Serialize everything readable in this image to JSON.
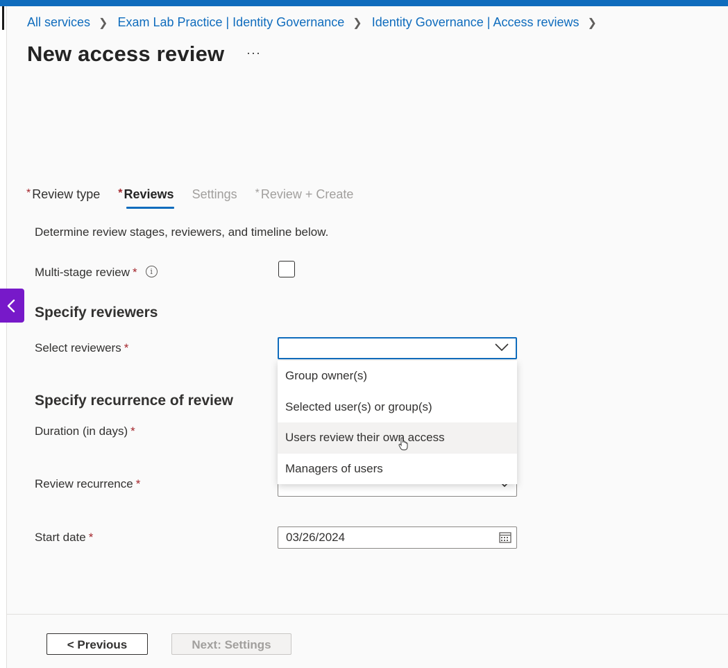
{
  "breadcrumb": {
    "items": [
      "All services",
      "Exam Lab Practice | Identity Governance",
      "Identity Governance | Access reviews"
    ]
  },
  "page": {
    "title": "New access review",
    "more_label": "···"
  },
  "tabs": [
    {
      "label": "Review type",
      "required": "*",
      "state": "normal"
    },
    {
      "label": "Reviews",
      "required": "*",
      "state": "active"
    },
    {
      "label": "Settings",
      "required": "",
      "state": "disabled"
    },
    {
      "label": "Review + Create",
      "required": "*",
      "state": "disabled"
    }
  ],
  "form": {
    "description": "Determine review stages, reviewers, and timeline below.",
    "multi_stage_label": "Multi-stage review",
    "multi_stage_checked": false,
    "required_mark": "*",
    "info_glyph": "i",
    "section_reviewers": "Specify reviewers",
    "select_reviewers_label": "Select reviewers",
    "select_reviewers_value": "",
    "section_recurrence": "Specify recurrence of review",
    "duration_label": "Duration (in days)",
    "recurrence_label": "Review recurrence",
    "start_date_label": "Start date",
    "start_date_value": "03/26/2024"
  },
  "dropdown": {
    "options": [
      "Group owner(s)",
      "Selected user(s) or group(s)",
      "Users review their own access",
      "Managers of users"
    ],
    "hovered_index": 2
  },
  "footer": {
    "previous_label": "< Previous",
    "next_label": "Next: Settings"
  },
  "colors": {
    "accent": "#0f6cbd",
    "required": "#a4262c",
    "sidebar_toggle": "#7719c9"
  }
}
